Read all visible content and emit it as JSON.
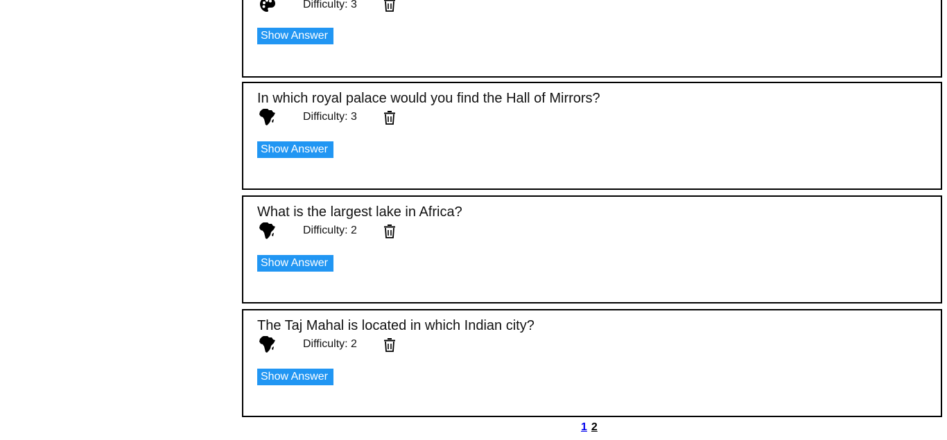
{
  "cards": [
    {
      "question": "",
      "category_icon": "palette-icon",
      "difficulty": "Difficulty: 3",
      "show_answer_label": "Show Answer"
    },
    {
      "question": "In which royal palace would you find the Hall of Mirrors?",
      "category_icon": "africa-map-icon",
      "difficulty": "Difficulty: 3",
      "show_answer_label": "Show Answer"
    },
    {
      "question": "What is the largest lake in Africa?",
      "category_icon": "africa-map-icon",
      "difficulty": "Difficulty: 2",
      "show_answer_label": "Show Answer"
    },
    {
      "question": "The Taj Mahal is located in which Indian city?",
      "category_icon": "africa-map-icon",
      "difficulty": "Difficulty: 2",
      "show_answer_label": "Show Answer"
    }
  ],
  "pagination": {
    "page_1": "1",
    "page_2": "2"
  },
  "colors": {
    "button_bg": "#2196f3",
    "button_text": "#ffffff",
    "card_border": "#000000",
    "link": "#0000ee"
  }
}
